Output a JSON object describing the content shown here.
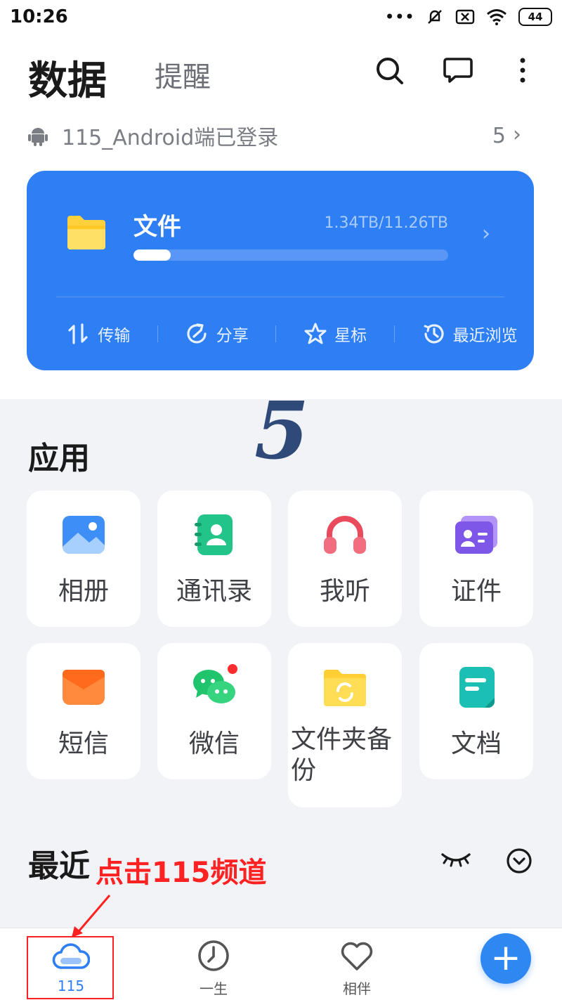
{
  "status_bar": {
    "time": "10:26",
    "battery": "44"
  },
  "header": {
    "title": "数据",
    "secondary_tab": "提醒"
  },
  "login_notice": {
    "text": "115_Android端已登录",
    "count": "5"
  },
  "storage_card": {
    "title": "文件",
    "usage": "1.34TB/11.26TB",
    "used_fraction": 0.119,
    "actions": [
      {
        "label": "传输",
        "icon": "transfer-icon"
      },
      {
        "label": "分享",
        "icon": "share-icon"
      },
      {
        "label": "星标",
        "icon": "star-icon"
      },
      {
        "label": "最近浏览",
        "icon": "history-icon"
      }
    ]
  },
  "watermark": "5",
  "apps": {
    "title": "应用",
    "items": [
      {
        "label": "相册",
        "icon": "photo-album-icon"
      },
      {
        "label": "通讯录",
        "icon": "contacts-icon"
      },
      {
        "label": "我听",
        "icon": "headphones-icon"
      },
      {
        "label": "证件",
        "icon": "id-card-icon"
      },
      {
        "label": "短信",
        "icon": "sms-icon"
      },
      {
        "label": "微信",
        "icon": "wechat-icon"
      },
      {
        "label": "文件夹备份",
        "icon": "folder-backup-icon"
      },
      {
        "label": "文档",
        "icon": "document-icon"
      }
    ]
  },
  "recent": {
    "title": "最近"
  },
  "annotation": {
    "text": "点击115频道"
  },
  "tabs": [
    {
      "label": "115",
      "icon": "cloud-icon",
      "active": true
    },
    {
      "label": "一生",
      "icon": "clock-icon",
      "active": false
    },
    {
      "label": "相伴",
      "icon": "heart-icon",
      "active": false
    }
  ],
  "fab": {
    "label": "+"
  },
  "colors": {
    "accent": "#2f7ff4",
    "annotation": "#ff2222"
  }
}
